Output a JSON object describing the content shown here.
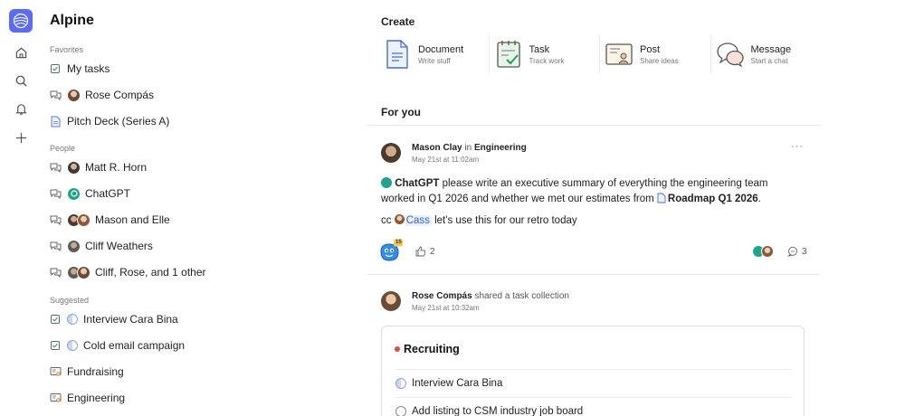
{
  "app": {
    "title": "Alpine"
  },
  "rail": {
    "icons": [
      "home-icon",
      "search-icon",
      "bell-icon",
      "plus-icon"
    ]
  },
  "sidebar": {
    "favorites_label": "Favorites",
    "favorites": [
      {
        "label": "My tasks",
        "icon": "task-icon"
      },
      {
        "label": "Rose Compás",
        "icon": "chat-icon"
      },
      {
        "label": "Pitch Deck (Series A)",
        "icon": "document-icon"
      }
    ],
    "people_label": "People",
    "people": [
      {
        "label": "Matt R. Horn"
      },
      {
        "label": "ChatGPT"
      },
      {
        "label": "Mason and Elle"
      },
      {
        "label": "Cliff Weathers"
      },
      {
        "label": "Cliff, Rose, and 1 other"
      }
    ],
    "suggested_label": "Suggested",
    "suggested": [
      {
        "label": "Interview Cara Bina"
      },
      {
        "label": "Cold email campaign"
      },
      {
        "label": "Fundraising"
      },
      {
        "label": "Engineering"
      }
    ]
  },
  "create": {
    "heading": "Create",
    "items": [
      {
        "title": "Document",
        "subtitle": "Write stuff"
      },
      {
        "title": "Task",
        "subtitle": "Track work"
      },
      {
        "title": "Post",
        "subtitle": "Share ideas"
      },
      {
        "title": "Message",
        "subtitle": "Start a chat"
      }
    ]
  },
  "feed": {
    "heading": "For you",
    "post1": {
      "author": "Mason Clay",
      "in_word": "in",
      "channel": "Engineering",
      "time": "May 21st at 11:02am",
      "more": "···",
      "mention": "ChatGPT",
      "text_a": " please write an executive summary of everything the engineering team",
      "text_b": "worked in Q1 2026 and whether we met our estimates from ",
      "doc_link": "Roadmap Q1 2026",
      "text_end": ".",
      "cc": "cc",
      "cc_mention": "Cass",
      "cc_text": " let's use this for our retro today",
      "sticker_badge": "15",
      "likes": "2",
      "comments": "3"
    },
    "post2": {
      "author": "Rose Compás",
      "action": "shared a task collection",
      "time": "May 21st at 10:32am",
      "collection_title": "Recruiting",
      "tasks": [
        {
          "label": "Interview Cara Bina"
        },
        {
          "label": "Add listing to CSM industry job board"
        }
      ]
    }
  },
  "colors": {
    "accent": "#5b6cf0",
    "mention": "#3a62c9",
    "red": "#e04b3b"
  }
}
